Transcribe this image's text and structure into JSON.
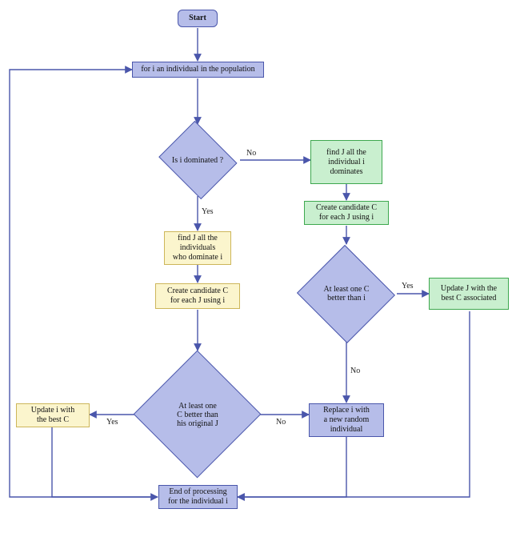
{
  "nodes": {
    "start": "Start",
    "loop": "for i an individual in the population",
    "q_dominated": "Is i dominated ?",
    "yes_findJ": "find J all the\nindividuals\nwho dominate i",
    "yes_createC": "Create candidate C\nfor each J using i",
    "q_betterThanOrigJ": "At least one\nC better than\nhis original J",
    "update_i": "Update i with\nthe best C",
    "no_findJ": "find J all the\nindividual i\ndominates",
    "no_createC": "Create candidate C\nfor each J using i",
    "q_betterThanI": "At least one C\nbetter than i",
    "update_J": "Update J with the\nbest C associated",
    "replace_i": "Replace i with\na new random\nindividual",
    "end": "End of processing\nfor the individual i"
  },
  "edges": {
    "yes": "Yes",
    "no": "No"
  }
}
